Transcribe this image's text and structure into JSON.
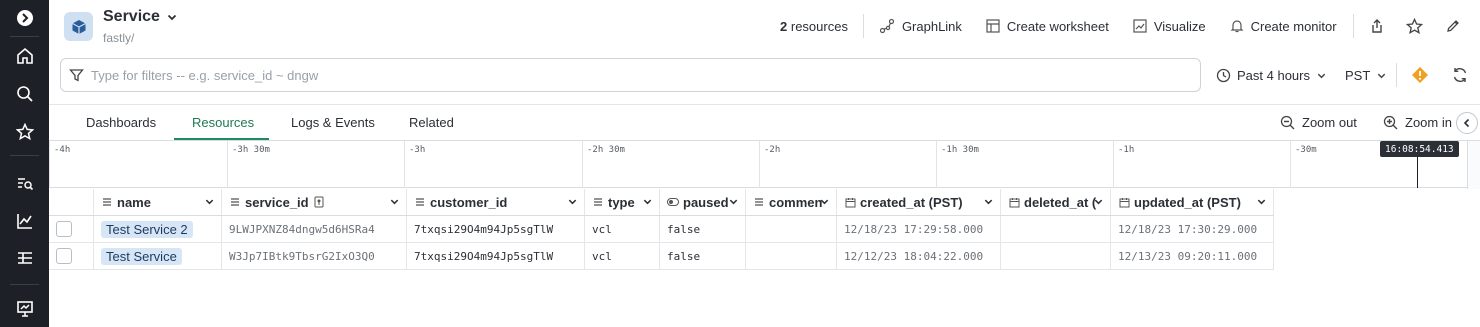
{
  "header": {
    "title": "Service",
    "subtitle": "fastly/",
    "resource_count": "2",
    "resource_label": "resources",
    "actions": {
      "graphlink": "GraphLink",
      "create_worksheet": "Create worksheet",
      "visualize": "Visualize",
      "create_monitor": "Create monitor"
    }
  },
  "filter": {
    "placeholder": "Type for filters -- e.g. service_id ~ dngw",
    "value": ""
  },
  "time": {
    "range": "Past 4 hours",
    "timezone": "PST"
  },
  "tabs": [
    {
      "label": "Dashboards"
    },
    {
      "label": "Resources"
    },
    {
      "label": "Logs & Events"
    },
    {
      "label": "Related"
    }
  ],
  "zoom": {
    "out": "Zoom out",
    "in": "Zoom in"
  },
  "timeline": {
    "ticks": [
      "-4h",
      "-3h 30m",
      "-3h",
      "-2h 30m",
      "-2h",
      "-1h 30m",
      "-1h",
      "-30m"
    ],
    "now": "16:08:54.413"
  },
  "table": {
    "columns": [
      "name",
      "service_id",
      "customer_id",
      "type",
      "paused",
      "commen",
      "created_at (PST)",
      "deleted_at (",
      "updated_at (PST)"
    ],
    "rows": [
      {
        "name": "Test Service 2",
        "service_id": "9LWJPXNZ84dngw5d6HSRa4",
        "customer_id": "7txqsi29O4m94Jp5sgTlW",
        "type": "vcl",
        "paused": "false",
        "comment": "",
        "created_at": "12/18/23 17:29:58.000",
        "deleted_at": "",
        "updated_at": "12/18/23 17:30:29.000"
      },
      {
        "name": "Test Service",
        "service_id": "W3Jp7IBtk9TbsrG2IxO3Q0",
        "customer_id": "7txqsi29O4m94Jp5sgTlW",
        "type": "vcl",
        "paused": "false",
        "comment": "",
        "created_at": "12/12/23 18:04:22.000",
        "deleted_at": "",
        "updated_at": "12/13/23 09:20:11.000"
      }
    ]
  },
  "colors": {
    "rail": "#1d2127",
    "accent_green": "#1e8a5e",
    "chip_bg": "#d6e6f7",
    "warning": "#f0a020"
  },
  "icons": [
    "arrow-right-circle-icon",
    "home-icon",
    "search-icon",
    "star-icon",
    "list-search-icon",
    "chart-icon",
    "table-icon",
    "presentation-icon"
  ]
}
